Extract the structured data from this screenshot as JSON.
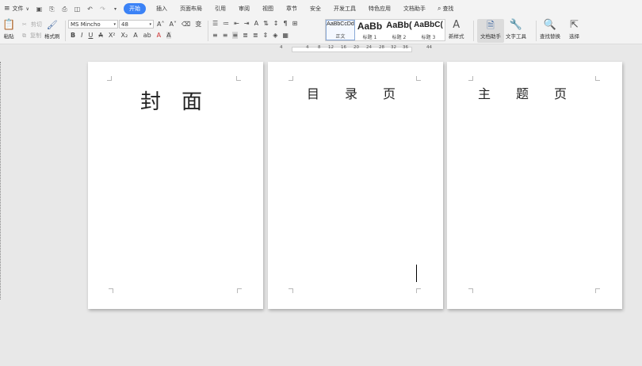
{
  "menubar": {
    "file_label": "文件",
    "tabs": [
      "开始",
      "插入",
      "页面布局",
      "引用",
      "审阅",
      "视图",
      "章节",
      "安全",
      "开发工具",
      "特色应用",
      "文档助手"
    ],
    "active_tab": "开始",
    "search_label": "查找"
  },
  "ribbon": {
    "paste_label": "粘贴",
    "cut_label": "剪切",
    "copy_label": "复制",
    "format_painter_label": "格式刷",
    "font_name": "MS Mincho",
    "font_size": "48",
    "styles": [
      {
        "sample": "AaBbCcDd",
        "caption": "正文"
      },
      {
        "sample": "AaBb",
        "caption": "标题 1"
      },
      {
        "sample": "AaBb(",
        "caption": "标题 2"
      },
      {
        "sample": "AaBbC(",
        "caption": "标题 3"
      }
    ],
    "new_style_label": "新样式",
    "doc_assistant_label": "文档助手",
    "text_tools_label": "文字工具",
    "find_replace_label": "查找替换",
    "select_label": "选择"
  },
  "ruler": {
    "labels": [
      "4",
      "4",
      "8",
      "12",
      "16",
      "20",
      "24",
      "28",
      "32",
      "36",
      "44"
    ]
  },
  "pages": [
    {
      "title": "封　面"
    },
    {
      "title": "目　　录　　页"
    },
    {
      "title": "主　　题　　页"
    }
  ],
  "colors": {
    "accent": "#3b82f6",
    "chrome": "#f3f3f3",
    "canvas": "#e8e8e8"
  }
}
